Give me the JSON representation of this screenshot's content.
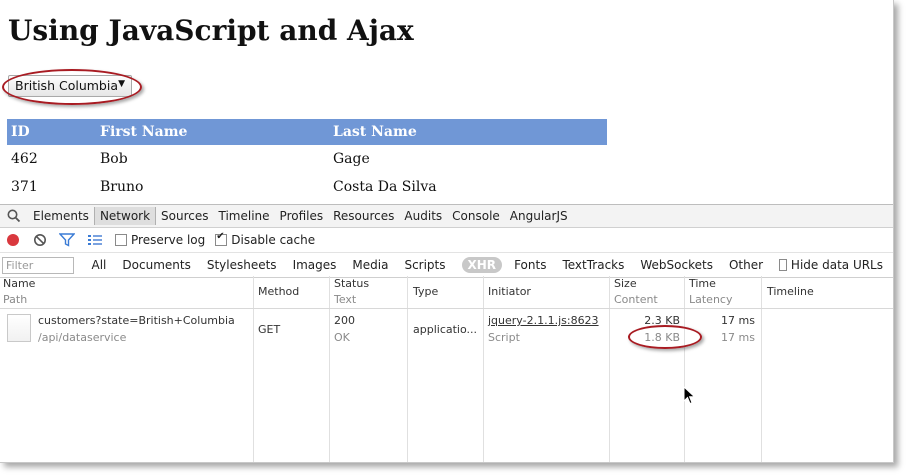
{
  "page": {
    "title": "Using JavaScript and Ajax"
  },
  "state_select": {
    "selected": "British Columbia"
  },
  "customers_table": {
    "headers": [
      "ID",
      "First Name",
      "Last Name"
    ],
    "rows": [
      [
        "462",
        "Bob",
        "Gage"
      ],
      [
        "371",
        "Bruno",
        "Costa Da Silva"
      ]
    ]
  },
  "devtools": {
    "tabs": [
      "Elements",
      "Network",
      "Sources",
      "Timeline",
      "Profiles",
      "Resources",
      "Audits",
      "Console",
      "AngularJS"
    ],
    "active_tab": "Network",
    "toolbar": {
      "preserve_log": "Preserve log",
      "disable_cache": "Disable cache",
      "preserve_log_checked": false,
      "disable_cache_checked": true
    },
    "filter": {
      "placeholder": "Filter",
      "types": [
        "All",
        "Documents",
        "Stylesheets",
        "Images",
        "Media",
        "Scripts",
        "XHR",
        "Fonts",
        "TextTracks",
        "WebSockets",
        "Other"
      ],
      "active_type": "XHR",
      "hide_data_urls": "Hide data URLs"
    },
    "columns": {
      "name": "Name",
      "path": "Path",
      "method": "Method",
      "status": "Status",
      "text": "Text",
      "type": "Type",
      "initiator": "Initiator",
      "size": "Size",
      "content": "Content",
      "time": "Time",
      "latency": "Latency",
      "timeline": "Timeline"
    },
    "request": {
      "name": "customers?state=British+Columbia",
      "path": "/api/dataservice",
      "method": "GET",
      "status": "200",
      "status_text": "OK",
      "type": "applicatio...",
      "initiator": "jquery-2.1.1.js:8623",
      "initiator_type": "Script",
      "size": "2.3 KB",
      "content": "1.8 KB",
      "time": "17 ms",
      "latency": "17 ms"
    }
  },
  "colors": {
    "table_header": "#7097d6",
    "highlight_ellipse": "#a81b22",
    "record_button": "#d9383e"
  }
}
